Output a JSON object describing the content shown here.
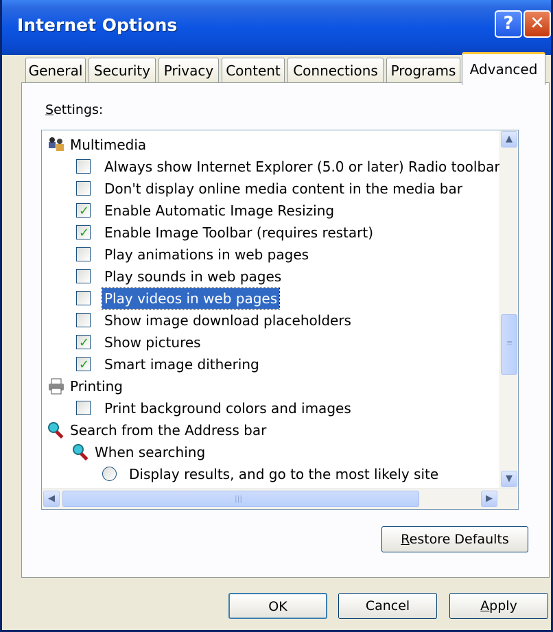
{
  "window": {
    "title": "Internet Options",
    "help_icon_glyph": "?",
    "close_icon_glyph": "✕"
  },
  "tabs": [
    {
      "label": "General"
    },
    {
      "label": "Security"
    },
    {
      "label": "Privacy"
    },
    {
      "label": "Content"
    },
    {
      "label": "Connections"
    },
    {
      "label": "Programs"
    },
    {
      "label": "Advanced",
      "active": true
    }
  ],
  "settings": {
    "label_first": "S",
    "label_rest": "ettings:",
    "rows": [
      {
        "type": "group",
        "icon": "multimedia-icon",
        "label": "Multimedia"
      },
      {
        "type": "checkbox",
        "checked": false,
        "label": "Always show Internet Explorer (5.0 or later) Radio toolbar"
      },
      {
        "type": "checkbox",
        "checked": false,
        "label": "Don't display online media content in the media bar"
      },
      {
        "type": "checkbox",
        "checked": true,
        "label": "Enable Automatic Image Resizing"
      },
      {
        "type": "checkbox",
        "checked": true,
        "label": "Enable Image Toolbar (requires restart)"
      },
      {
        "type": "checkbox",
        "checked": false,
        "label": "Play animations in web pages"
      },
      {
        "type": "checkbox",
        "checked": false,
        "label": "Play sounds in web pages"
      },
      {
        "type": "checkbox",
        "checked": false,
        "label": "Play videos in web pages",
        "selected": true
      },
      {
        "type": "checkbox",
        "checked": false,
        "label": "Show image download placeholders"
      },
      {
        "type": "checkbox",
        "checked": true,
        "label": "Show pictures"
      },
      {
        "type": "checkbox",
        "checked": true,
        "label": "Smart image dithering"
      },
      {
        "type": "group",
        "icon": "printer-icon",
        "label": "Printing"
      },
      {
        "type": "checkbox",
        "checked": false,
        "label": "Print background colors and images"
      },
      {
        "type": "group",
        "icon": "magnifier-icon",
        "label": "Search from the Address bar"
      },
      {
        "type": "subgroup",
        "icon": "magnifier-icon",
        "label": "When searching"
      },
      {
        "type": "radio",
        "checked": false,
        "label": "Display results, and go to the most likely site"
      }
    ]
  },
  "buttons": {
    "restore_defaults": {
      "accel": "R",
      "rest": "estore Defaults"
    },
    "ok": "OK",
    "cancel": "Cancel",
    "apply": {
      "accel": "A",
      "rest": "pply"
    }
  },
  "colors": {
    "titlebar": "#0a4ad0",
    "selection": "#316ac5",
    "checkmark": "#21a121"
  }
}
